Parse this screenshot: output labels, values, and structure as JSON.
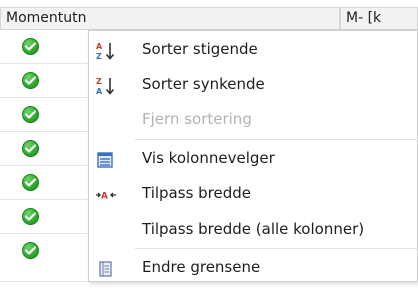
{
  "grid": {
    "columns": [
      {
        "label": "Momentutn"
      },
      {
        "label": "M-   [k"
      }
    ],
    "row_count": 7,
    "status_icon": "check-circle-icon",
    "status_color": "#2fae2f"
  },
  "menu": {
    "items": [
      {
        "label": "Sorter stigende",
        "icon": "sort-ascending-icon",
        "enabled": true
      },
      {
        "label": "Sorter synkende",
        "icon": "sort-descending-icon",
        "enabled": true
      },
      {
        "label": "Fjern sortering",
        "icon": "",
        "enabled": false
      },
      {
        "label": "Vis kolonnevelger",
        "icon": "column-chooser-icon",
        "enabled": true
      },
      {
        "label": "Tilpass bredde",
        "icon": "fit-width-icon",
        "enabled": true
      },
      {
        "label": "Tilpass bredde (alle kolonner)",
        "icon": "",
        "enabled": true
      },
      {
        "label": "Endre grensene",
        "icon": "edit-limits-icon",
        "enabled": true
      }
    ]
  },
  "colors": {
    "accent_blue": "#3a6fc4",
    "accent_red": "#d23a2a",
    "disabled_text": "#b3b3b3"
  }
}
